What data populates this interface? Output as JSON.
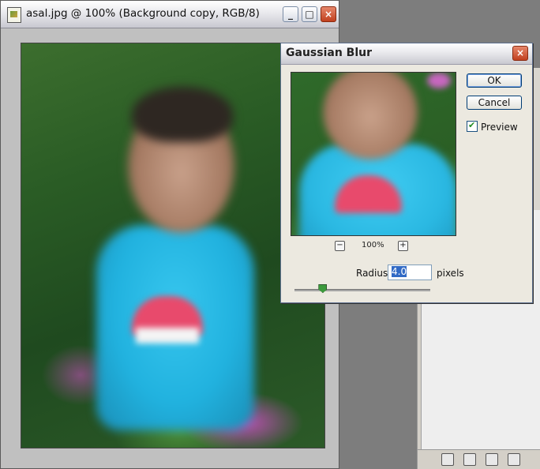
{
  "document_window": {
    "title": "asal.jpg @ 100% (Background copy, RGB/8)",
    "minimize": "_",
    "maximize": "□",
    "close": "×"
  },
  "dialog": {
    "title": "Gaussian Blur",
    "close": "×",
    "ok_label": "OK",
    "cancel_label": "Cancel",
    "preview_label": "Preview",
    "preview_checked": true,
    "zoom_minus": "−",
    "zoom_plus": "+",
    "zoom_level": "100%",
    "radius_label": "Radius:",
    "radius_value": "4.0",
    "radius_unit": "pixels",
    "radius_slider_position": 0.2
  },
  "colors": {
    "accent": "#316ac5",
    "close_button": "#c1401f",
    "shirt": "#21b2df"
  },
  "icons": [
    "document-icon",
    "zoom-out-icon",
    "zoom-in-icon",
    "checkmark-icon"
  ]
}
